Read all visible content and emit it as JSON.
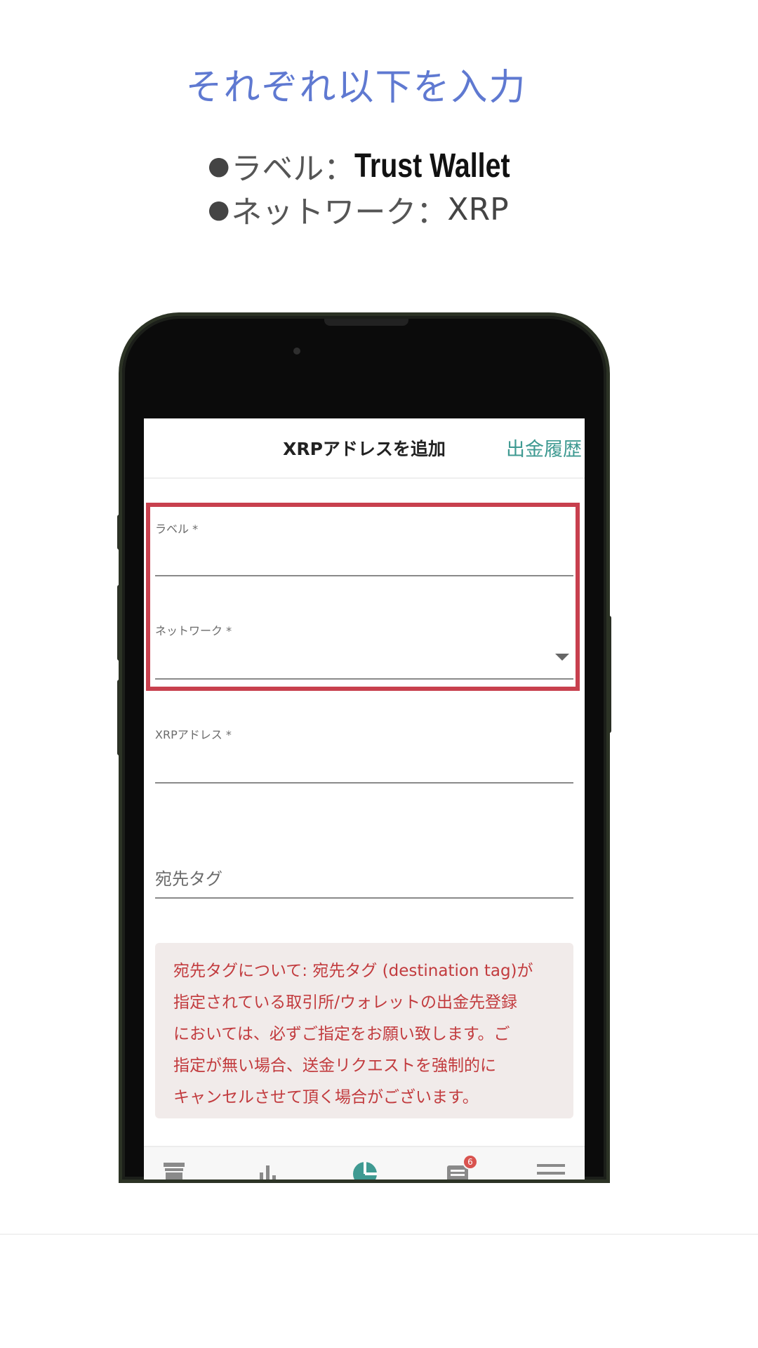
{
  "headline": "それぞれ以下を入力",
  "instructions": [
    {
      "bullet": "●",
      "label": "ラベル：",
      "value": "Trust Wallet"
    },
    {
      "bullet": "●",
      "label": "ネットワーク：",
      "value": "XRP"
    }
  ],
  "app": {
    "title": "XRPアドレスを追加",
    "header_link": "出金履歴",
    "fields": {
      "label": "ラベル *",
      "network": "ネットワーク *",
      "address": "XRPアドレス *",
      "destination_tag": "宛先タグ"
    },
    "notice_lines": [
      "宛先タグについて: 宛先タグ (destination tag)が",
      "指定されている取引所/ウォレットの出金先登録",
      "においては、必ずご指定をお願い致します。ご",
      "指定が無い場合、送金リクエストを強制的に",
      "キャンセルさせて頂く場合がございます。"
    ],
    "tabbar": {
      "badge_count": "6",
      "icons": [
        "store-icon",
        "bar-chart-icon",
        "pie-chart-icon",
        "news-icon",
        "menu-icon"
      ]
    }
  },
  "colors": {
    "headline": "#5f79d1",
    "highlight_border": "#c8404e",
    "link": "#3f9a92",
    "notice_text": "#c23b3e",
    "notice_bg": "#f1ebea",
    "badge": "#d9534f"
  }
}
